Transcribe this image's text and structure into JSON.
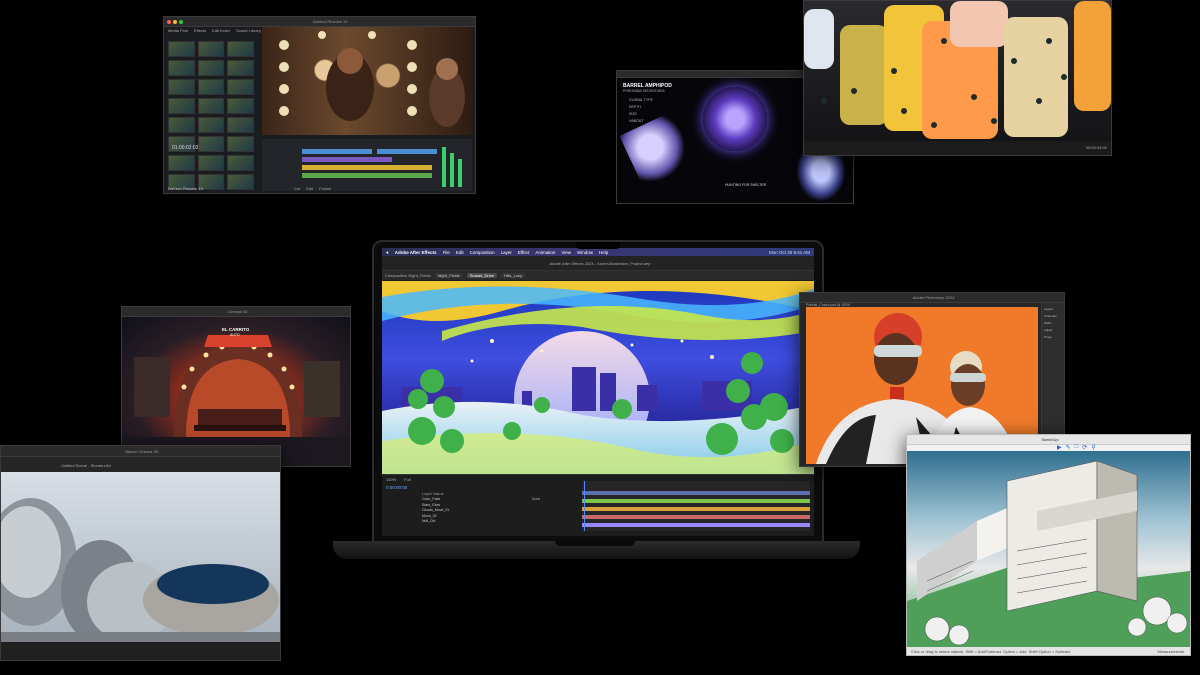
{
  "resolve": {
    "title": "DaVinci Resolve 19",
    "timecode": "01:00:02:03",
    "brand": "DaVinci Resolve 19",
    "menu": [
      "Media Pool",
      "Effects",
      "Edit Index",
      "Sound Library"
    ],
    "tab_labels": [
      "Cut",
      "Edit",
      "Fusion"
    ]
  },
  "shader": {
    "heading": "BARREL AMPHIPOD",
    "subheading": "PHRONIMA SEDENTARIA",
    "fields": [
      "GLOBAL TYPE",
      "DEPTH",
      "SIZE",
      "HABITAT"
    ],
    "caption": "HUNTING FOR SHELTER"
  },
  "render": {
    "timecode": "00:00:04:00"
  },
  "laptop": {
    "app_menu": [
      "Adobe After Effects",
      "File",
      "Edit",
      "Composition",
      "Layer",
      "Effect",
      "Animation",
      "View",
      "Window",
      "Help"
    ],
    "clock": "Mon Oct 30 9:41 AM",
    "window_title": "Adobe After Effects 2024 - /Users/Illustration_Project.aep",
    "panel_title": "Composition Night_Fields",
    "tabs": [
      "Night_Fields",
      "Sunset_Drive",
      "Hills_Loop"
    ],
    "timecode": "0:00:00:00",
    "zoom": "100%",
    "quality": "Full",
    "layers": [
      "Color_Fade",
      "Stars_Glow",
      "Clouds_Move_01",
      "Moon_02",
      "Null_Ctrl"
    ],
    "layer_header": "Layer Name",
    "blend": "None"
  },
  "cafe": {
    "title": "Cinema 4D",
    "sign": "EL CARRITO",
    "sign_sub": "AUTO"
  },
  "stones": {
    "title": "Maxon Cinema 4D",
    "subtitle": "Untitled Scene - Stones.c4d"
  },
  "ps": {
    "title": "Adobe Photoshop 2024",
    "doc_tab": "Portrait_Colour.psd @ 100%",
    "layers": [
      "Layers",
      "Channels",
      "Paths",
      "Adjust",
      "Props"
    ]
  },
  "sketch": {
    "title": "SketchUp",
    "status": "Click or drag to select objects. Shift = Add/Subtract. Option = Add. Shift+Option = Subtract",
    "measure": "Measurements"
  },
  "colors": {
    "accent_ae": "#9b86ff",
    "ps_orange": "#f07a2a",
    "timeline_green": "#7cc54a"
  }
}
